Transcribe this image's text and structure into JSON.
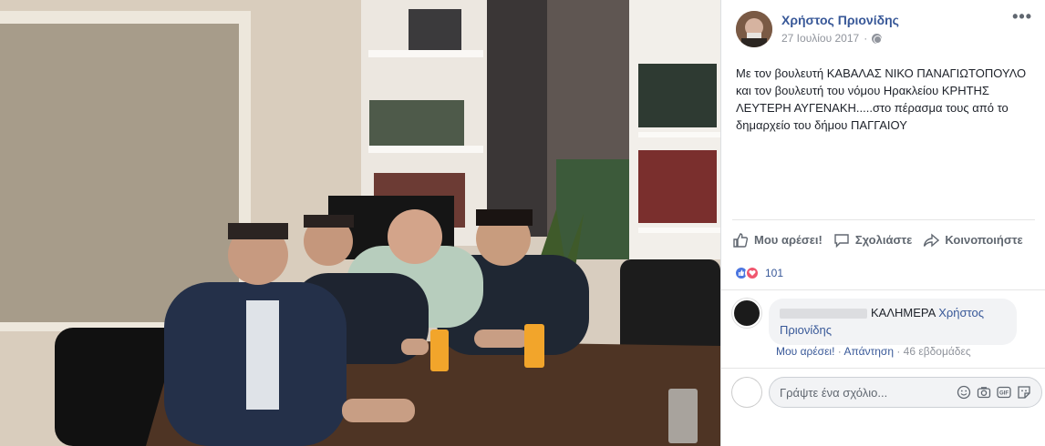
{
  "post": {
    "author": "Χρήστος Πριονίδης",
    "date": "27 Ιουλίου 2017",
    "more_label": "•••",
    "text": "Με τον βουλευτή ΚΑΒΑΛΑΣ ΝΙΚΟ ΠΑΝΑΓΙΩΤΟΠΟΥΛΟ και τον βουλευτή του νόμου Ηρακλείου ΚΡΗΤΗΣ ΛΕΥΤΕΡΗ ΑΥΓΕΝΑΚΗ.....στο πέρασμα τους από το δημαρχείο του δήμου ΠΑΓΓΑΙΟΥ"
  },
  "actions": {
    "like": "Μου αρέσει!",
    "comment": "Σχολιάστε",
    "share": "Κοινοποιήστε"
  },
  "reactions": {
    "count": "101"
  },
  "comment": {
    "text": "ΚΑΛΗΜΕΡΑ",
    "mention": "Χρήστος Πριονίδης",
    "like": "Μου αρέσει!",
    "reply": "Απάντηση",
    "time": "46 εβδομάδες",
    "dot": " · "
  },
  "composer": {
    "placeholder": "Γράψτε ένα σχόλιο...",
    "gif_label": "GIF"
  },
  "colors": {
    "link": "#385898",
    "meta": "#90949c",
    "like_reaction": "#4c76e0",
    "love_reaction": "#f0566e"
  },
  "icons": [
    "globe-icon",
    "thumbs-up-icon",
    "speech-bubble-icon",
    "share-arrow-icon",
    "smiley-icon",
    "camera-icon",
    "gif-icon",
    "sticker-icon"
  ]
}
